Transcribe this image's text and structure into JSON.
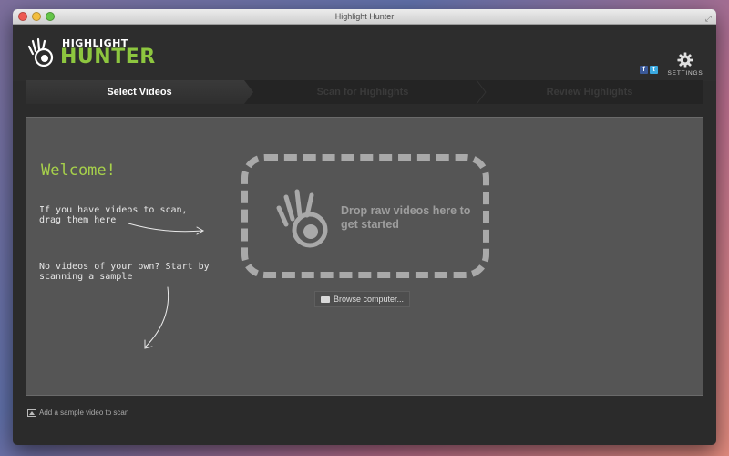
{
  "window": {
    "title": "Highlight Hunter"
  },
  "logo": {
    "line1": "HIGHLIGHT",
    "line2": "HUNTER"
  },
  "header": {
    "social": {
      "facebook": "f",
      "twitter": "t"
    },
    "settings_label": "SETTINGS"
  },
  "steps": [
    {
      "label": "Select Videos",
      "active": true
    },
    {
      "label": "Scan for Highlights",
      "active": false
    },
    {
      "label": "Review Highlights",
      "active": false
    }
  ],
  "main": {
    "welcome": "Welcome!",
    "hint_drag": "If you have videos to scan, drag them here",
    "hint_sample": "No videos of your own? Start by scanning a sample",
    "drop_text": "Drop raw videos here to get started",
    "browse_label": "Browse computer..."
  },
  "footer": {
    "sample_link": "Add a sample video to scan"
  },
  "colors": {
    "accent": "#8dc63f",
    "welcome": "#a7d14b",
    "facebook": "#3b5998",
    "twitter": "#3ba9e0"
  },
  "icons": [
    "hand-logo-icon",
    "facebook-icon",
    "twitter-icon",
    "gear-icon",
    "folder-icon",
    "image-icon"
  ]
}
